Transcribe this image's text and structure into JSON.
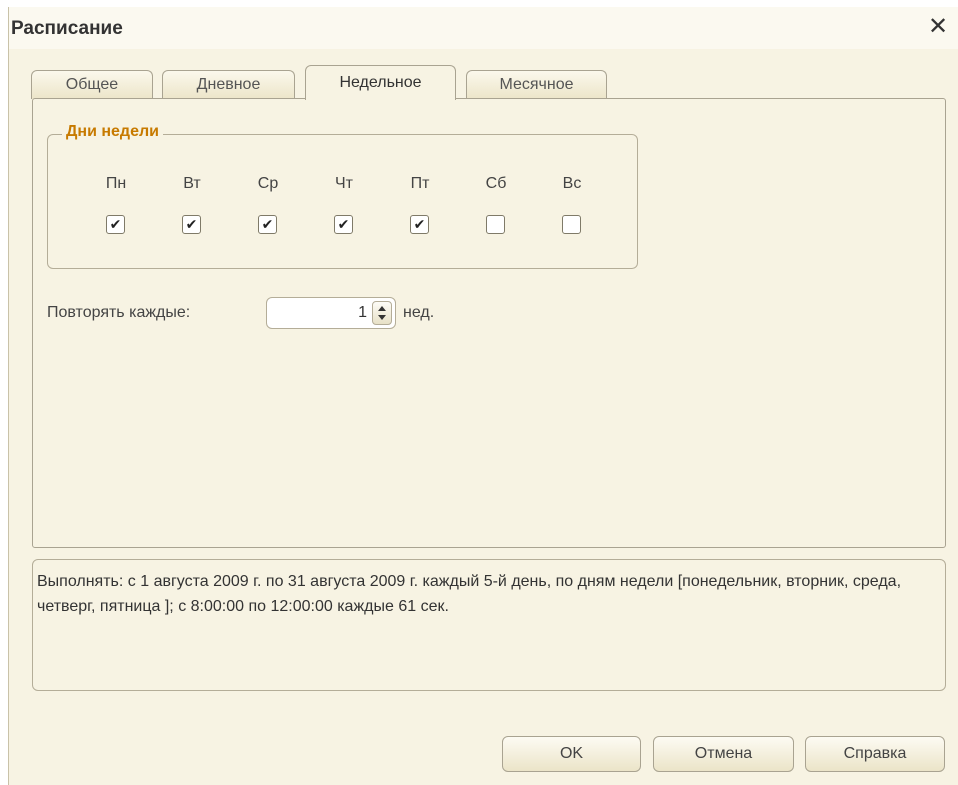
{
  "window": {
    "title": "Расписание",
    "close_symbol": "✕"
  },
  "tabs": [
    {
      "label": "Общее",
      "active": false
    },
    {
      "label": "Дневное",
      "active": false
    },
    {
      "label": "Недельное",
      "active": true
    },
    {
      "label": "Месячное",
      "active": false
    }
  ],
  "weekdays": {
    "group_title": "Дни недели",
    "days": [
      {
        "label": "Пн",
        "checked": true
      },
      {
        "label": "Вт",
        "checked": true
      },
      {
        "label": "Ср",
        "checked": true
      },
      {
        "label": "Чт",
        "checked": true
      },
      {
        "label": "Пт",
        "checked": true
      },
      {
        "label": "Сб",
        "checked": false
      },
      {
        "label": "Вс",
        "checked": false
      }
    ]
  },
  "repeat": {
    "label": "Повторять каждые:",
    "value": "1",
    "unit": "нед."
  },
  "description": "Выполнять: с 1 августа 2009 г. по 31 августа 2009 г. каждый 5-й день, по дням недели [понедельник, вторник, среда, четверг, пятница ]; с 8:00:00 по 12:00:00 каждые 61 сек.",
  "buttons": {
    "ok": "OK",
    "cancel": "Отмена",
    "help": "Справка"
  },
  "colors": {
    "accent": "#c77a00",
    "background": "#f7f3e3"
  }
}
